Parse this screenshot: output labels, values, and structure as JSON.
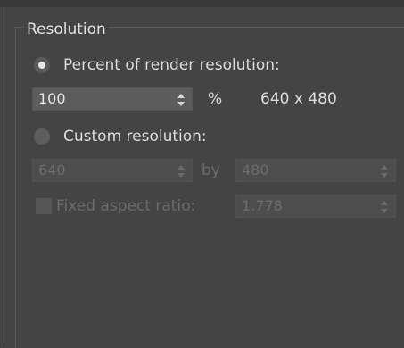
{
  "group": {
    "title": "Resolution"
  },
  "percent_option": {
    "label": "Percent of render resolution:",
    "selected": true
  },
  "percent_field": {
    "value": "100",
    "unit": "%",
    "computed_resolution": "640 x 480"
  },
  "custom_option": {
    "label": "Custom resolution:",
    "selected": false
  },
  "custom_fields": {
    "width": "640",
    "by_label": "by",
    "height": "480"
  },
  "aspect": {
    "label": "Fixed aspect ratio:",
    "checked": false,
    "value": "1.778"
  },
  "icons": {
    "spinner_arrows": "up-down-arrows-icon"
  },
  "colors": {
    "background": "#444444",
    "text": "#dcdcdc",
    "disabled_text": "#6c6c6c",
    "field": "#5c5c5c"
  }
}
